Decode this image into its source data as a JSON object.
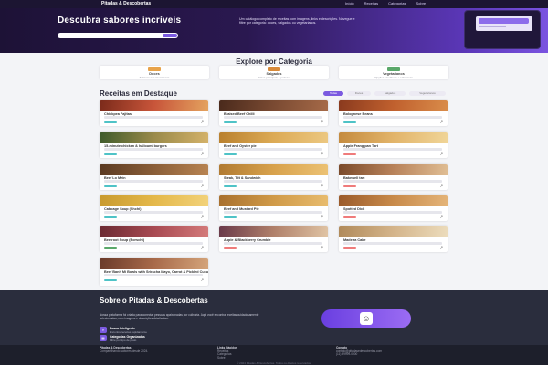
{
  "nav": {
    "brand": "Pitadas & Descobertas",
    "links": [
      "Início",
      "Receitas",
      "Categorias",
      "Sobre"
    ]
  },
  "hero": {
    "title": "Descubra sabores incríveis",
    "search_placeholder": "",
    "description": "Um catálogo completo de receitas com imagens, links e descrições. Navegue e filtre por categoria: doces, salgados ou vegetarianos."
  },
  "categories": {
    "title": "Explore por Categoria",
    "items": [
      {
        "name": "Doces",
        "desc": "Sobremesas irresistíveis",
        "color": "#e8a34a"
      },
      {
        "name": "Salgados",
        "desc": "Pratos principais e petiscos",
        "color": "#d88a3a"
      },
      {
        "name": "Vegetarianos",
        "desc": "Opções saudáveis e saborosas",
        "color": "#5aa86a"
      }
    ]
  },
  "recipes": {
    "title": "Receitas em Destaque",
    "filters": [
      "Todas",
      "Doces",
      "Salgados",
      "Vegetarianos"
    ],
    "items": [
      {
        "name": "Chickpea Fajitas",
        "tag_color": "#4fc3c7",
        "img": [
          "#7a2a1a",
          "#c8553a",
          "#e4a35f"
        ]
      },
      {
        "name": "Braised Beef Chilli",
        "tag_color": "#4fc3c7",
        "img": [
          "#4a2a1c",
          "#7a4a32",
          "#a66a48"
        ]
      },
      {
        "name": "Bolognese Beans",
        "tag_color": "#4fc3c7",
        "img": [
          "#8a3a1e",
          "#c0602e",
          "#d98c4a"
        ]
      },
      {
        "name": "15-minute chicken & halloumi burgers",
        "tag_color": "#4fc3c7",
        "img": [
          "#3d5a2a",
          "#9a8a4a",
          "#d4b26a"
        ]
      },
      {
        "name": "Beef and Oyster pie",
        "tag_color": "#4fc3c7",
        "img": [
          "#b9802e",
          "#dcaa55",
          "#ecc882"
        ]
      },
      {
        "name": "Apple Frangipan Tart",
        "tag_color": "#ef7b7b",
        "img": [
          "#c48a3e",
          "#e2b46a",
          "#f0d598"
        ]
      },
      {
        "name": "Beef Lo Mein",
        "tag_color": "#4fc3c7",
        "img": [
          "#5a3a22",
          "#8a5e38",
          "#b88452"
        ]
      },
      {
        "name": "Steak, Tilt & Sandwich",
        "tag_color": "#4fc3c7",
        "img": [
          "#b07a32",
          "#d8a24c",
          "#ecc274"
        ]
      },
      {
        "name": "Bakewell tart",
        "tag_color": "#ef7b7b",
        "img": [
          "#7a4a2a",
          "#b8825a",
          "#e0be94"
        ]
      },
      {
        "name": "Cabbage Soup (Shchi)",
        "tag_color": "#4fc3c7",
        "img": [
          "#c89a2e",
          "#e4b84a",
          "#f2d27a"
        ]
      },
      {
        "name": "Beef and Mustard Pie",
        "tag_color": "#4fc3c7",
        "img": [
          "#a8702e",
          "#d09a48",
          "#e8bc6e"
        ]
      },
      {
        "name": "Spotted Dick",
        "tag_color": "#ef7b7b",
        "img": [
          "#9a5a2a",
          "#c88a4a",
          "#e4b478"
        ]
      },
      {
        "name": "Beetroot Soup (Borscht)",
        "tag_color": "#5aa86a",
        "img": [
          "#6a2a32",
          "#a84a52",
          "#d47a7a"
        ]
      },
      {
        "name": "Apple & Blackberry Crumble",
        "tag_color": "#ef7b7b",
        "img": [
          "#6a3a4a",
          "#b0806a",
          "#e0c4a4"
        ]
      },
      {
        "name": "Madeira Cake",
        "tag_color": "#ef7b7b",
        "img": [
          "#b08a5a",
          "#d4b48a",
          "#ecdcbc"
        ]
      },
      {
        "name": "Beef Banh Mi Bowls with Sriracha Mayo, Carrot & Pickled Cucumber",
        "tag_color": "#4fc3c7",
        "img": [
          "#6a3a2a",
          "#a86a4a",
          "#d4a47a"
        ]
      }
    ]
  },
  "about": {
    "title": "Sobre o Pitadas & Descobertas",
    "text": "Nossa plataforma foi criada para conectar pessoas apaixonadas por culinária. Aqui você encontra receitas cuidadosamente selecionadas, com imagens e descrições detalhadas.",
    "features": [
      {
        "title": "Busca Inteligente",
        "desc": "Encontre receitas rapidamente"
      },
      {
        "title": "Categorias Organizadas",
        "desc": "Filtre por tipo de prato"
      }
    ]
  },
  "footer": {
    "col1_title": "Pitadas & Descobertas",
    "col1_text": "Compartilhando sabores desde 2024.",
    "col2_title": "Links Rápidos",
    "col2_links": [
      "Receitas",
      "Categorias",
      "Sobre"
    ],
    "col3_title": "Contato",
    "col3_lines": [
      "contato@pitadasedescobertas.com",
      "(11) 99999-0000"
    ],
    "copyright": "© 2024 Pitadas & Descobertas. Todos os direitos reservados."
  }
}
